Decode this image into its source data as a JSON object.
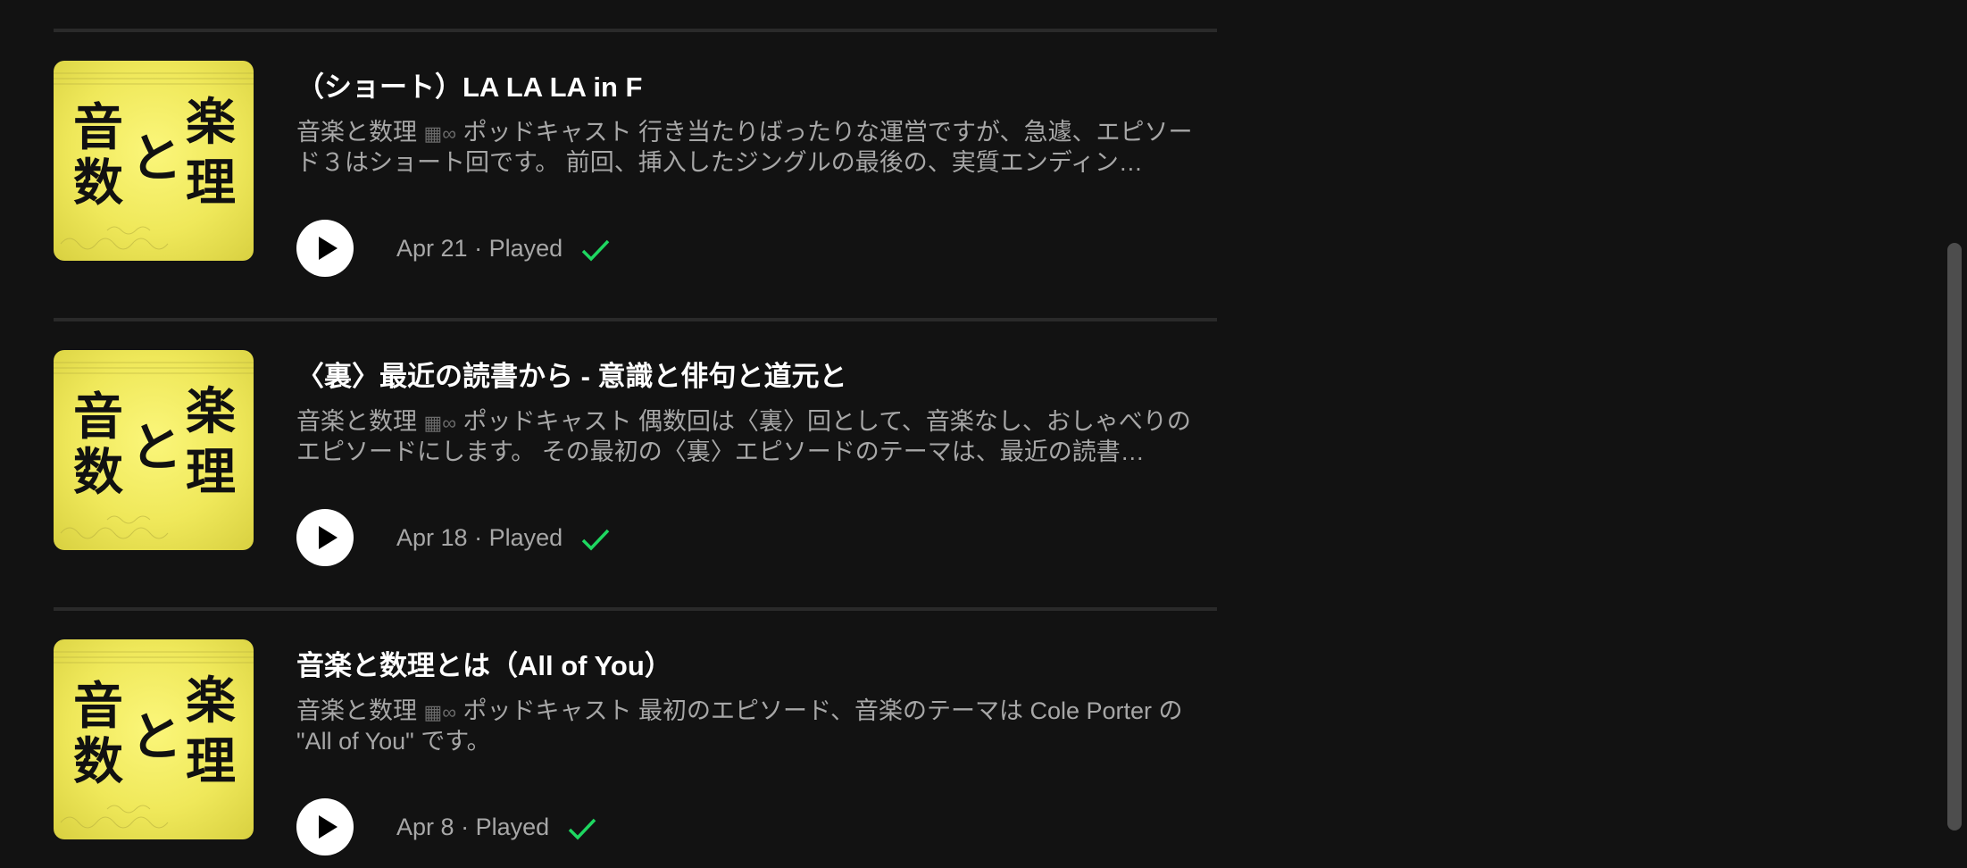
{
  "episodes": [
    {
      "title": "（ショート）LA LA LA in F",
      "show_name": "音楽と数理",
      "kind": "ポッドキャスト",
      "description": "行き当たりばったりな運営ですが、急遽、エピソード３はショート回です。 前回、挿入したジングルの最後の、実質エンディン…",
      "date": "Apr 21",
      "status": "Played",
      "play_icon": "play-icon",
      "status_icon": "checkmark-icon"
    },
    {
      "title": "〈裏〉最近の読書から - 意識と俳句と道元と",
      "show_name": "音楽と数理",
      "kind": "ポッドキャスト",
      "description": "偶数回は〈裏〉回として、音楽なし、おしゃべりのエピソードにします。 その最初の〈裏〉エピソードのテーマは、最近の読書…",
      "date": "Apr 18",
      "status": "Played",
      "play_icon": "play-icon",
      "status_icon": "checkmark-icon"
    },
    {
      "title": "音楽と数理とは（All of You）",
      "show_name": "音楽と数理",
      "kind": "ポッドキャスト",
      "description": "最初のエピソード、音楽のテーマは Cole Porter の \"All of You\" です。",
      "date": "Apr 8",
      "status": "Played",
      "play_icon": "play-icon",
      "status_icon": "checkmark-icon"
    }
  ],
  "cover_art": {
    "chars": [
      "音",
      "楽",
      "と",
      "数",
      "理"
    ]
  },
  "meta_separator": "·",
  "colors": {
    "background": "#121212",
    "title": "#ffffff",
    "secondary_text": "#a7a7a7",
    "played_check": "#1ed760",
    "cover_yellow": "#f3ec62",
    "divider": "#2a2a2a"
  }
}
